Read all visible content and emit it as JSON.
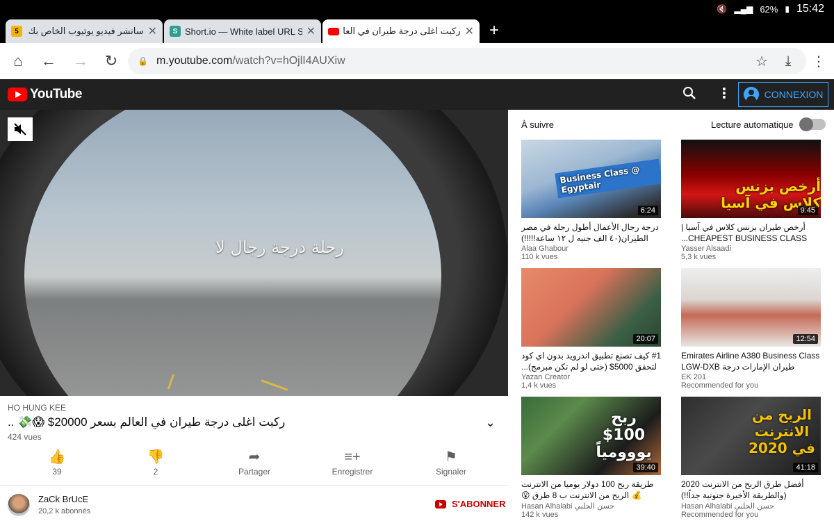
{
  "status_bar": {
    "battery": "62%",
    "time": "15:42"
  },
  "tabs": [
    {
      "title": "سانشر فيديو يوتيوب الخاص بك على",
      "favicon_label": "5",
      "favicon_color": "#f4b400"
    },
    {
      "title": "Short.io — White label URL Sho",
      "favicon_label": "S",
      "favicon_color": "#2f9e8f"
    },
    {
      "title": "ركبت اغلى درجة طيران في العالم",
      "favicon_label": "",
      "favicon_color": "#ff0000"
    }
  ],
  "toolbar": {
    "url_domain": "m.youtube.com",
    "url_path": "/watch?v=hOjlI4AUXiw"
  },
  "header": {
    "brand": "YouTube",
    "signin_label": "CONNEXION"
  },
  "player": {
    "overlay_caption": "رحلة درجة رجال لا"
  },
  "video": {
    "channel_line": "HO HUNG KEE",
    "title": "ركبت اغلى درجة طيران في العالم بسعر 20000$ 😱💸 ..",
    "views": "424 vues",
    "actions": [
      {
        "icon": "thumb-up-icon",
        "label": "39"
      },
      {
        "icon": "thumb-down-icon",
        "label": "2"
      },
      {
        "icon": "share-icon",
        "label": "Partager"
      },
      {
        "icon": "playlist-add-icon",
        "label": "Enregistrer"
      },
      {
        "icon": "flag-icon",
        "label": "Signaler"
      }
    ],
    "owner": {
      "name": "ZaCk BrUcE",
      "subscribers": "20,2 k abonnés"
    },
    "subscribe_label": "S'ABONNER"
  },
  "sidebar": {
    "up_next_label": "À suivre",
    "autoplay_label": "Lecture automatique",
    "cards": [
      {
        "title": "درجة رجال الأعمال أطول رحلة في مصر الطيران(٤٠ الف جنيه ل ١٢ ساعة!!!!!)",
        "channel": "Alaa Ghabour",
        "meta": "110 k vues",
        "duration": "6:24",
        "thumb_text": "Business Class @ Egyptair"
      },
      {
        "title": "أرخص طيران بزنس كلاس في آسيا | CHEAPEST BUSINESS CLASS...",
        "channel": "Yasser Alsaadi",
        "meta": "5,3 k vues",
        "duration": "9:45",
        "thumb_text": "أرخص بزنس كلاس في آسيا"
      },
      {
        "title": "#1 كيف تصنع تطبيق اندرويد بدون اي كود لتحقق 5000$ (حتى لو لم تكن مبرمج)...",
        "channel": "Yazan Creator",
        "meta": "1,4 k vues",
        "duration": "20:07",
        "thumb_text": ""
      },
      {
        "title": "Emirates Airline A380 Business Class LGW-DXB طيران الإمارات درجة",
        "channel": "EK 201",
        "meta": "Recommended for you",
        "duration": "12:54",
        "thumb_text": ""
      },
      {
        "title": "طريقة ربح 100 دولار يوميا من الانترنت 💰 الربح من الانترنت ب 8 طرق 😮",
        "channel": "Hasan Alhalabi حسن الحلبي",
        "meta": "142 k vues",
        "duration": "39:40",
        "thumb_text": "ربح 100$ يووومياً"
      },
      {
        "title": "أفضل طرق الربح من الانترنت 2020 (والطريقة الأخيرة جنونية جداً!!)",
        "channel": "Hasan Alhalabi حسن الحلبي",
        "meta": "Recommended for you",
        "duration": "41:18",
        "thumb_text": "الربح من الانترنت في 2020"
      }
    ]
  }
}
